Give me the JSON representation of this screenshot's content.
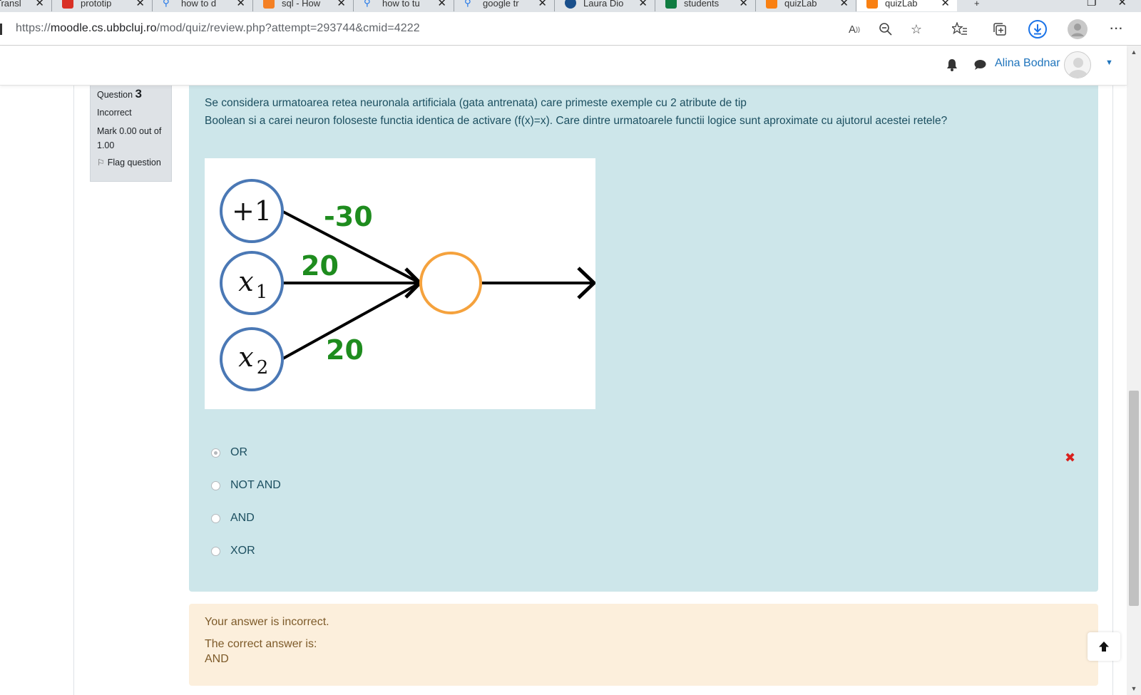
{
  "browser": {
    "tabs": [
      {
        "label": "Transl",
        "icon": "translate-icon",
        "color": "#4285f4"
      },
      {
        "label": "prototip",
        "icon": "pdf-icon",
        "color": "#d93025"
      },
      {
        "label": "how to d",
        "icon": "search-icon",
        "color": "#1a73e8"
      },
      {
        "label": "sql - How",
        "icon": "stackoverflow-icon",
        "color": "#f48024"
      },
      {
        "label": "how to tu",
        "icon": "search-icon",
        "color": "#1a73e8"
      },
      {
        "label": "google tr",
        "icon": "search-icon",
        "color": "#1a73e8"
      },
      {
        "label": "Laura Dio",
        "icon": "profile-icon",
        "color": "#1a4f8b"
      },
      {
        "label": "students",
        "icon": "excel-icon",
        "color": "#107c41"
      },
      {
        "label": "quizLab",
        "icon": "moodle-icon",
        "color": "#f98012"
      },
      {
        "label": "quizLab",
        "icon": "moodle-icon",
        "color": "#f98012"
      }
    ],
    "url_prefix": "https://",
    "url_host": "moodle.cs.ubbcluj.ro",
    "url_path": "/mod/quiz/review.php?attempt=293744&cmid=4222"
  },
  "navbar": {
    "user_name": "Alina Bodnar"
  },
  "question_info": {
    "question_label": "Question",
    "question_number": "3",
    "state": "Incorrect",
    "mark": "Mark 0.00 out of 1.00",
    "flag": "Flag question"
  },
  "question": {
    "text_line1": "Se considera urmatoarea retea neuronala artificiala (gata antrenata) care primeste exemple cu 2 atribute de tip",
    "text_line2": "Boolean si a carei neuron foloseste functia identica de activare (f(x)=x). Care dintre urmatoarele functii logice sunt aproximate cu ajutorul acestei retele?",
    "diagram": {
      "bias_label": "+1",
      "x1_label": "x",
      "x1_sub": "1",
      "x2_label": "x",
      "x2_sub": "2",
      "w0": "-30",
      "w1": "20",
      "w2": "20",
      "node_color": "#4a78b5",
      "output_color": "#f5a23d",
      "weight_color": "#1e8c1e"
    },
    "options": [
      {
        "label": "OR",
        "selected": true
      },
      {
        "label": "NOT AND",
        "selected": false
      },
      {
        "label": "AND",
        "selected": false
      },
      {
        "label": "XOR",
        "selected": false
      }
    ],
    "result_icon": "✖"
  },
  "feedback": {
    "status": "Your answer is incorrect.",
    "correct_label": "The correct answer is:",
    "correct_answer": "AND"
  }
}
